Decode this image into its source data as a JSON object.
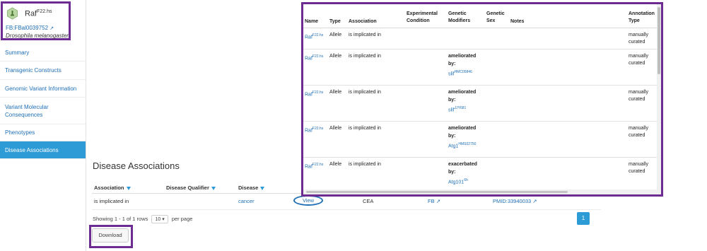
{
  "allele": {
    "symbol": "Raf",
    "symbol_sup": "F22.hs",
    "fb_id": "FB:FBal0039752",
    "species": "Drosophila melanogaster"
  },
  "sidebar": {
    "items": [
      {
        "label": "Summary"
      },
      {
        "label": "Transgenic Constructs"
      },
      {
        "label": "Genomic Variant Information"
      },
      {
        "label": "Variant Molecular Consequences"
      },
      {
        "label": "Phenotypes"
      },
      {
        "label": "Disease Associations"
      }
    ]
  },
  "main": {
    "section_title": "Disease Associations",
    "columns": {
      "association": "Association",
      "qualifier": "Disease Qualifier",
      "disease": "Disease"
    },
    "row": {
      "association": "is implicated in",
      "disease": "cancer",
      "view": "View",
      "evidence": "CEA",
      "source": "FB",
      "reference": "PMID:33940033"
    },
    "pager": {
      "showing": "Showing 1 - 1 of 1 rows",
      "page_size": "10",
      "per_page": "per page",
      "current_page": "1"
    },
    "download_label": "Download"
  },
  "popup": {
    "headers": {
      "name": "Name",
      "type": "Type",
      "association": "Association",
      "condition": "Experimental Condition",
      "modifiers": "Genetic Modifiers",
      "sex": "Genetic Sex",
      "notes": "Notes",
      "annotation": "Annotation Type"
    },
    "rows": [
      {
        "name": "Raf",
        "name_sup": "F22.hs",
        "type": "Allele",
        "association": "is implicated in",
        "mod_label": "",
        "mod_by": "",
        "mod_gene": "",
        "mod_sup": "",
        "annotation": "manually curated"
      },
      {
        "name": "Raf",
        "name_sup": "F22.hs",
        "type": "Allele",
        "association": "is implicated in",
        "mod_label": "ameliorated",
        "mod_by": "by:",
        "mod_gene": "slif",
        "mod_sup": "HMC05846",
        "annotation": "manually curated"
      },
      {
        "name": "Raf",
        "name_sup": "F22.hs",
        "type": "Allele",
        "association": "is implicated in",
        "mod_label": "ameliorated",
        "mod_by": "by:",
        "mod_gene": "slif",
        "mod_sup": "JJY681",
        "annotation": "manually curated"
      },
      {
        "name": "Raf",
        "name_sup": "F22.hs",
        "type": "Allele",
        "association": "is implicated in",
        "mod_label": "ameliorated",
        "mod_by": "by:",
        "mod_gene": "Atg1",
        "mod_sup": "HMS02750",
        "annotation": "manually curated"
      },
      {
        "name": "Raf",
        "name_sup": "F22.hs",
        "type": "Allele",
        "association": "is implicated in",
        "mod_label": "exacerbated",
        "mod_by": "by:",
        "mod_gene": "Atg101",
        "mod_sup": "6h",
        "annotation": "manually curated"
      }
    ]
  },
  "colors": {
    "highlight_frame": "#6c2c91",
    "link": "#1f6fb5",
    "accent": "#2d9bd6"
  },
  "icons": [
    "allele-icon",
    "external-link-icon",
    "filter-icon",
    "dropdown-caret-icon"
  ]
}
